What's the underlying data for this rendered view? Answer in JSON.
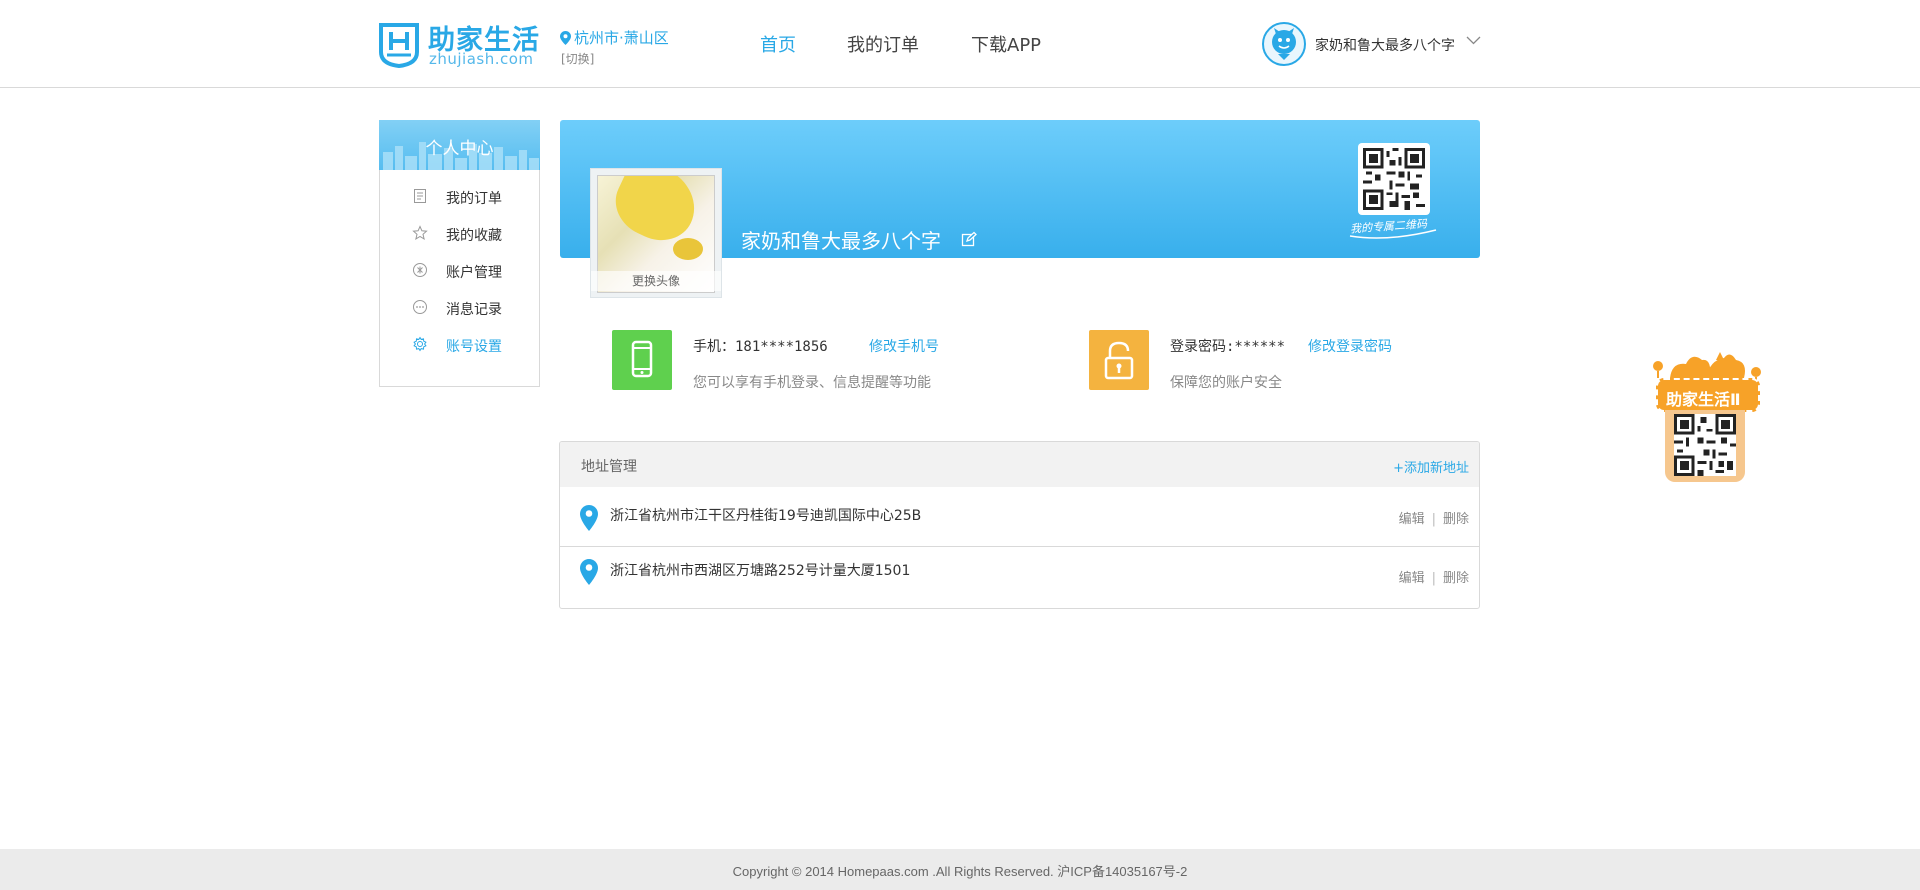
{
  "header": {
    "logo_cn": "助家生活",
    "logo_en": "zhujiash.com",
    "city": "杭州市·萧山区",
    "city_switch": "[切换]",
    "nav": [
      "首页",
      "我的订单",
      "下载APP"
    ],
    "active_nav": "首页",
    "user_name": "家奶和鲁大最多八个字"
  },
  "sidebar": {
    "title": "个人中心",
    "items": [
      {
        "label": "我的订单",
        "icon": "document-icon"
      },
      {
        "label": "我的收藏",
        "icon": "star-icon"
      },
      {
        "label": "账户管理",
        "icon": "account-icon"
      },
      {
        "label": "消息记录",
        "icon": "message-icon"
      },
      {
        "label": "账号设置",
        "icon": "gear-icon",
        "active": true
      }
    ]
  },
  "profile": {
    "name": "家奶和鲁大最多八个字",
    "avatar_caption": "更换头像",
    "qr_caption": "我的专属二维码"
  },
  "phone": {
    "label": "手机：181****1856",
    "link": "修改手机号",
    "desc": "您可以享有手机登录、信息提醒等功能"
  },
  "password": {
    "label": "登录密码:******",
    "link": "修改登录密码",
    "desc": "保障您的账户安全"
  },
  "address": {
    "title": "地址管理",
    "add_label": "+添加新地址",
    "rows": [
      {
        "text": "浙江省杭州市江干区丹桂街19号迪凯国际中心25B",
        "edit": "编辑",
        "delete": "删除"
      },
      {
        "text": "浙江省杭州市西湖区万塘路252号计量大厦1501",
        "edit": "编辑",
        "delete": "删除"
      }
    ]
  },
  "mascot": {
    "label": "助家生活Ⅱ"
  },
  "footer": {
    "copyright": "Copyright © 2014 Homepaas.com .All Rights Reserved. 沪ICP备14035167号-2"
  },
  "colors": {
    "brand_blue": "#29a8e6",
    "phone_green": "#5fd04e",
    "lock_orange": "#f4b33f"
  }
}
